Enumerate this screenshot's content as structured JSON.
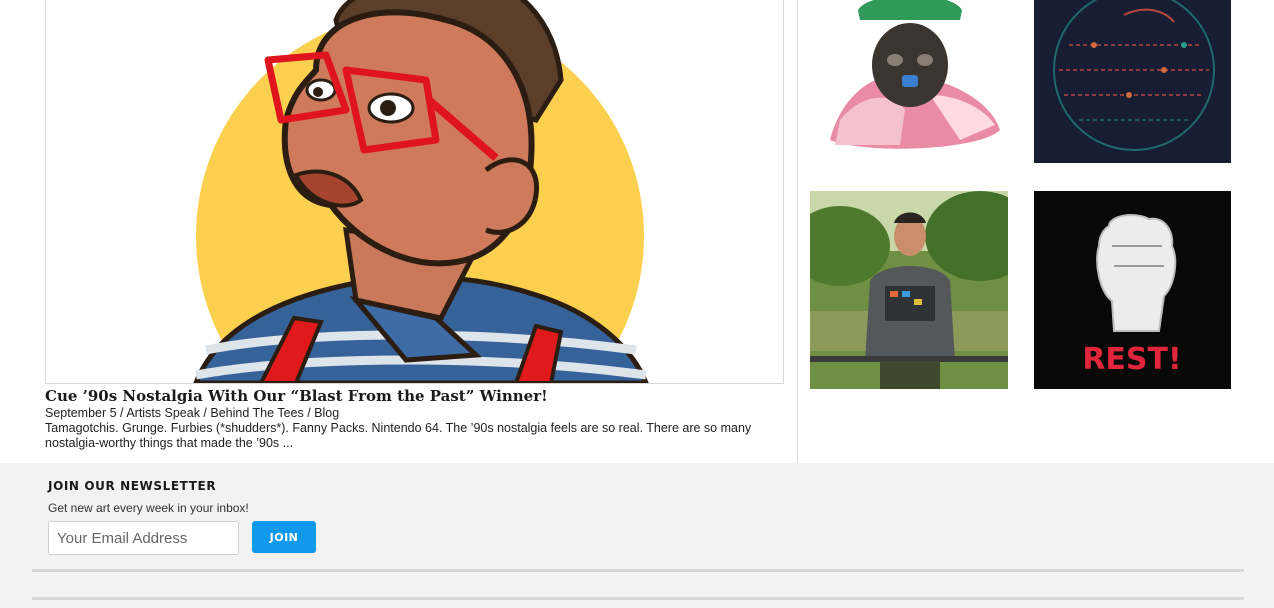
{
  "post": {
    "title": "Cue ’90s Nostalgia With Our “Blast From the Past” Winner!",
    "date": "September 5",
    "separator": " / ",
    "categories": [
      "Artists Speak",
      "Behind The Tees",
      "Blog"
    ],
    "excerpt": "Tamagotchis. Grunge. Furbies (*shudders*). Fanny Packs. Nintendo 64. The ’90s nostalgia feels are so real. There are so many nostalgia-worthy things that made the ’90s ..."
  },
  "thumbnails": {
    "fist_text": "REST!"
  },
  "newsletter": {
    "heading": "JOIN OUR NEWSLETTER",
    "subtext": "Get new art every week in your inbox!",
    "email_placeholder": "Your Email Address",
    "button_label": "JOIN"
  },
  "colors": {
    "accent_button": "#1199ee",
    "footer_bg": "#f2f2f2",
    "hero_circle": "#fcd04f",
    "glasses_red": "#e0141e"
  }
}
